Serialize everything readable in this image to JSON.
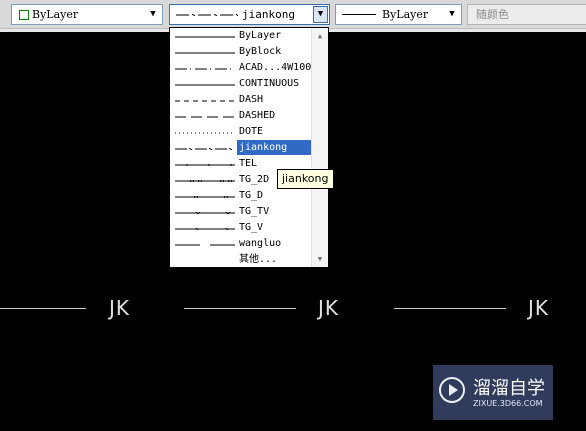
{
  "toolbar": {
    "color_label": "ByLayer",
    "linetype_label": "jiankong",
    "lineweight_label": "ByLayer",
    "plotstyle_label": "随颜色"
  },
  "dropdown": {
    "items": [
      {
        "label": "ByLayer",
        "pattern": "solid"
      },
      {
        "label": "ByBlock",
        "pattern": "solid"
      },
      {
        "label": "ACAD...4W100",
        "pattern": "dashdot"
      },
      {
        "label": "CONTINUOUS",
        "pattern": "solid"
      },
      {
        "label": "DASH",
        "pattern": "dash"
      },
      {
        "label": "DASHED",
        "pattern": "longdash"
      },
      {
        "label": "DOTE",
        "pattern": "dot"
      },
      {
        "label": "jiankong",
        "pattern": "jk"
      },
      {
        "label": "TEL",
        "pattern": "tel"
      },
      {
        "label": "TG_2D",
        "pattern": "tg2d"
      },
      {
        "label": "TG_D",
        "pattern": "tgd"
      },
      {
        "label": "TG_TV",
        "pattern": "tgtv"
      },
      {
        "label": "TG_V",
        "pattern": "tgv"
      },
      {
        "label": "wangluo",
        "pattern": "gap"
      },
      {
        "label": "其他...",
        "pattern": "none"
      }
    ],
    "selected_index": 7
  },
  "tooltip": "jiankong",
  "drawing": {
    "jk_labels": [
      "JK",
      "JK",
      "JK"
    ]
  },
  "watermark": {
    "title": "溜溜自学",
    "url": "ZIXUE.3D66.COM"
  },
  "colors": {
    "canvas": "#000000",
    "selection": "#316ac5",
    "tooltip_bg": "#ffffe1"
  }
}
